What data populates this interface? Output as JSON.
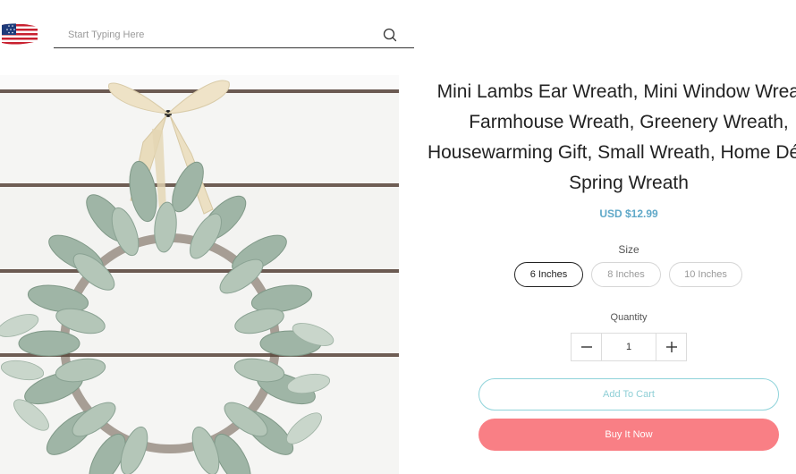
{
  "header": {
    "flag_icon": "us-flag-icon",
    "search": {
      "placeholder": "Start Typing Here",
      "value": "",
      "icon": "search-icon"
    }
  },
  "product": {
    "image_description_icon": "lambs-ear-wreath-image",
    "title": "Mini Lambs Ear Wreath, Mini Window Wreath, Farmhouse Wreath, Greenery Wreath, Housewarming Gift, Small Wreath, Home Décor, Spring Wreath",
    "price": "USD $12.99",
    "size_label": "Size",
    "sizes": [
      {
        "label": "6 Inches",
        "selected": true
      },
      {
        "label": "8 Inches",
        "selected": false
      },
      {
        "label": "10 Inches",
        "selected": false
      }
    ],
    "quantity_label": "Quantity",
    "quantity_value": "1",
    "add_to_cart_label": "Add To Cart",
    "buy_now_label": "Buy It Now"
  },
  "colors": {
    "price": "#5fa8c8",
    "add_to_cart_border": "#8fd3da",
    "buy_now_bg": "#f97f85"
  }
}
